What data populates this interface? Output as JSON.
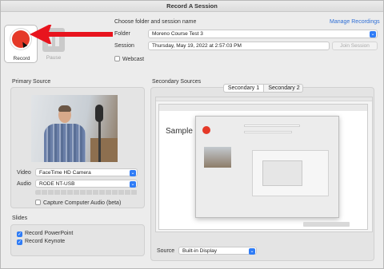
{
  "window": {
    "title": "Record A Session"
  },
  "toolbar": {
    "record_label": "Record",
    "pause_label": "Pause"
  },
  "session": {
    "heading": "Choose folder and session name",
    "manage_link": "Manage Recordings",
    "folder_label": "Folder",
    "folder_value": "Moreno Course Test 3",
    "session_label": "Session",
    "session_value": "Thursday, May 19, 2022 at 2:57:03 PM",
    "join_label": "Join Session",
    "webcast_label": "Webcast",
    "webcast_checked": false
  },
  "primary": {
    "title": "Primary Source",
    "video_label": "Video",
    "video_value": "FaceTime HD Camera",
    "audio_label": "Audio",
    "audio_value": "RODE NT-USB",
    "capture_audio_label": "Capture Computer Audio (beta)",
    "capture_audio_checked": false
  },
  "slides": {
    "title": "Slides",
    "items": [
      {
        "label": "Record PowerPoint",
        "checked": true
      },
      {
        "label": "Record Keynote",
        "checked": true
      }
    ]
  },
  "secondary": {
    "title": "Secondary Sources",
    "tabs": [
      {
        "label": "Secondary 1",
        "active": true
      },
      {
        "label": "Secondary 2",
        "active": false
      }
    ],
    "preview_text": "Sample Course",
    "source_label": "Source",
    "source_value": "Built-in Display"
  },
  "colors": {
    "record_red": "#e53928",
    "annotation_arrow": "#e8141e",
    "link_blue": "#2f6fd6",
    "control_blue": "#2f7cf6"
  }
}
